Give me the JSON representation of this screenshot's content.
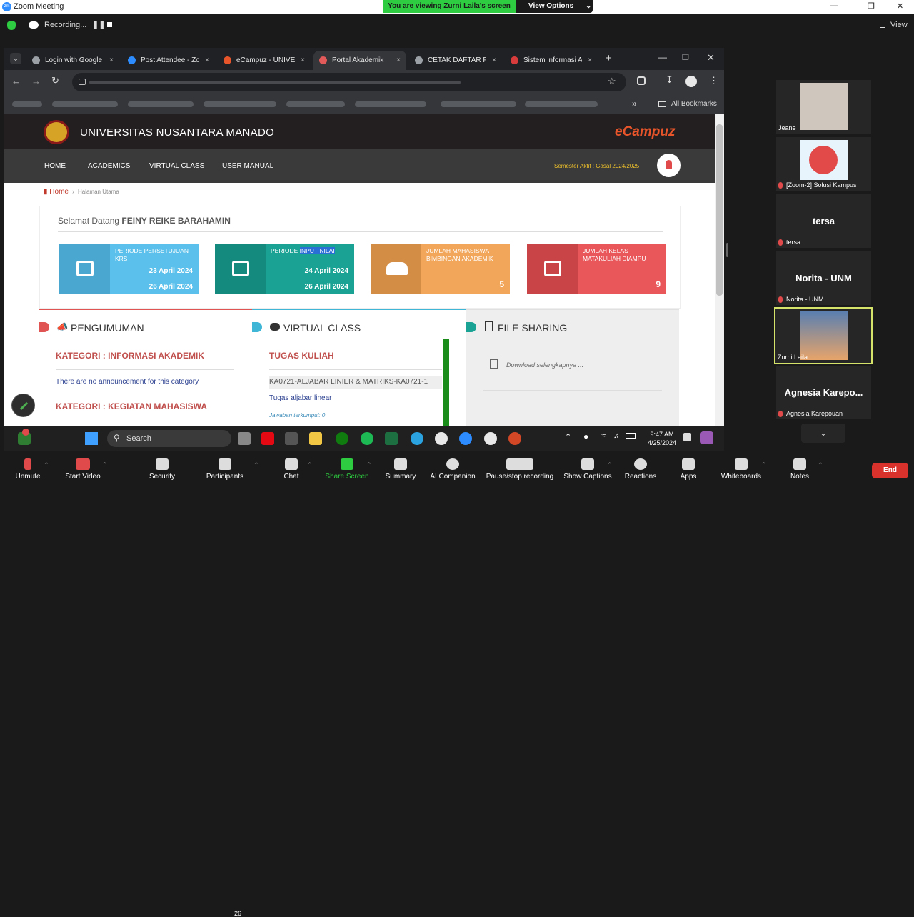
{
  "zoom": {
    "window_title": "Zoom Meeting",
    "share_banner": "You are viewing Zurni Laila's screen",
    "view_options": "View Options",
    "recording": "Recording...",
    "view": "View",
    "logo": "zm"
  },
  "browser": {
    "tabs": [
      {
        "label": "Login with Google",
        "color": "#9aa0a6"
      },
      {
        "label": "Post Attendee - Zoom",
        "color": "#2d8cff"
      },
      {
        "label": "eCampuz - UNIVE",
        "color": "#e8552a"
      },
      {
        "label": "Portal Akademik",
        "color": "#e25a5a"
      },
      {
        "label": "CETAK DAFTAR PE",
        "color": "#9aa0a6"
      },
      {
        "label": "Sistem informasi Ak",
        "color": "#d73b3b"
      }
    ],
    "bookmarks_all": "All Bookmarks"
  },
  "site": {
    "university": "UNIVERSITAS NUSANTARA MANADO",
    "brand": "eCampuz",
    "nav": [
      "HOME",
      "ACADEMICS",
      "VIRTUAL CLASS",
      "USER MANUAL"
    ],
    "semester": "Semester Aktif : Gasal 2024/2025",
    "breadcrumb": {
      "home": "Home",
      "current": "Halaman Utama"
    },
    "welcome_prefix": "Selamat Datang",
    "welcome_name": "FEINY REIKE BARAHAMIN",
    "cards": [
      {
        "label": "PERIODE PERSETUJUAN KRS",
        "date1": "23 April 2024",
        "date2": "26 April 2024",
        "color": "#5bc0eb",
        "dark": "#4aa8d0"
      },
      {
        "label_a": "PERIODE ",
        "label_b": "INPUT NILAI",
        "date1": "24 April 2024",
        "date2": "26 April 2024",
        "color": "#1aa394",
        "dark": "#138a7d"
      },
      {
        "label": "JUMLAH MAHASISWA BIMBINGAN AKADEMIK",
        "num": "5",
        "color": "#f2a65a",
        "dark": "#d48d45"
      },
      {
        "label": "JUMLAH KELAS MATAKULIAH DIAMPU",
        "num": "9",
        "color": "#e9575a",
        "dark": "#c84447"
      }
    ],
    "pengumuman": {
      "title": "PENGUMUMAN",
      "kategori1": "KATEGORI : INFORMASI AKADEMIK",
      "empty": "There are no announcement for this category",
      "kategori2": "KATEGORI : KEGIATAN MAHASISWA"
    },
    "virtual": {
      "title": "VIRTUAL CLASS",
      "tugas": "TUGAS KULIAH",
      "course": "KA0721-ALJABAR LINIER & MATRIKS-KA0721-1",
      "task": "Tugas aljabar linear",
      "jawaban": "Jawaban terkumpul: 0"
    },
    "file": {
      "title": "FILE SHARING",
      "download": "Download selengkapnya ..."
    }
  },
  "taskbar": {
    "search": "Search",
    "time": "9:47 AM",
    "date": "4/25/2024"
  },
  "participants": [
    {
      "name": "Jeane",
      "big": ""
    },
    {
      "name": "[Zoom-2] Solusi Kampus",
      "big": ""
    },
    {
      "name": "tersa",
      "big": "tersa"
    },
    {
      "name": "Norita - UNM",
      "big": "Norita - UNM"
    },
    {
      "name": "Zurni Laila",
      "big": ""
    },
    {
      "name": "Agnesia Karepouan",
      "big": "Agnesia  Karepo..."
    }
  ],
  "toolbar": {
    "items": [
      "Unmute",
      "Start Video",
      "Security",
      "Participants",
      "Chat",
      "Share Screen",
      "Summary",
      "AI Companion",
      "Pause/stop recording",
      "Show Captions",
      "Reactions",
      "Apps",
      "Whiteboards",
      "Notes"
    ],
    "participants_count": "26",
    "end": "End"
  }
}
